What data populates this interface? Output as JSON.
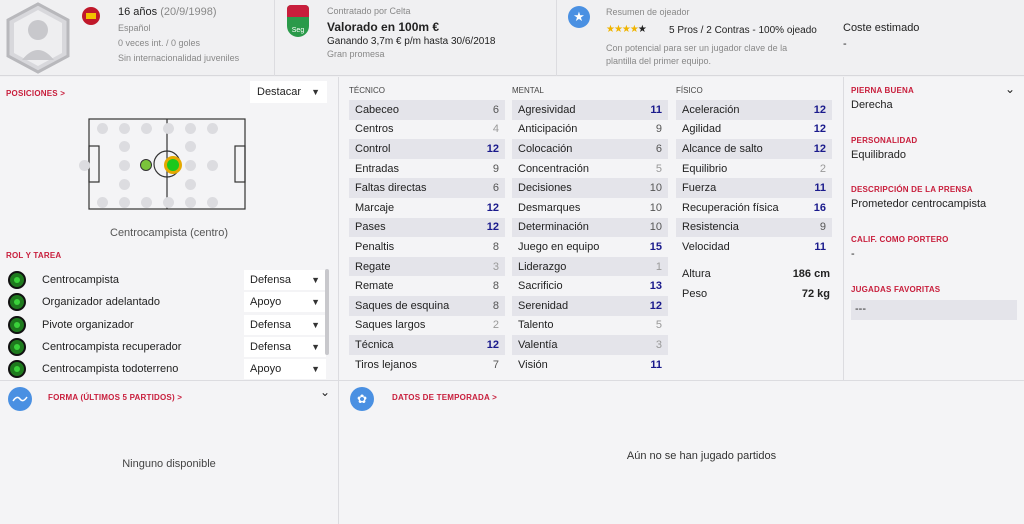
{
  "header": {
    "age_label": "16 años",
    "birth_date": "(20/9/1998)",
    "nationality": "Español",
    "international": "0 veces int. / 0 goles",
    "youth_caps": "Sin internacionalidad juveniles",
    "contract_label": "Contratado por Celta",
    "value": "Valorado en 100m €",
    "wage": "Ganando 3,7m € p/m hasta 30/6/2018",
    "prospect": "Gran promesa",
    "club_badge_text": "Seg",
    "scout_title": "Resumen de ojeador",
    "scout_stars": 4,
    "scout_summary": "5 Pros / 2 Contras - 100% ojeado",
    "scout_note": "Con potencial para ser un jugador clave de la plantilla del primer equipo.",
    "cost_label": "Coste estimado",
    "cost_value": "-"
  },
  "positions": {
    "title": "POSICIONES >",
    "dropdown": "Destacar",
    "position_label": "Centrocampista (centro)"
  },
  "roles": {
    "title": "ROL Y TAREA",
    "items": [
      {
        "name": "Centrocampista",
        "duty": "Defensa"
      },
      {
        "name": "Organizador adelantado",
        "duty": "Apoyo"
      },
      {
        "name": "Pivote organizador",
        "duty": "Defensa"
      },
      {
        "name": "Centrocampista recuperador",
        "duty": "Defensa"
      },
      {
        "name": "Centrocampista todoterreno",
        "duty": "Apoyo"
      }
    ]
  },
  "attributes": {
    "technical_title": "TÉCNICO",
    "mental_title": "MENTAL",
    "physical_title": "FÍSICO",
    "technical": [
      {
        "name": "Cabeceo",
        "value": "6"
      },
      {
        "name": "Centros",
        "value": "4"
      },
      {
        "name": "Control",
        "value": "12"
      },
      {
        "name": "Entradas",
        "value": "9"
      },
      {
        "name": "Faltas directas",
        "value": "6"
      },
      {
        "name": "Marcaje",
        "value": "12"
      },
      {
        "name": "Pases",
        "value": "12"
      },
      {
        "name": "Penaltis",
        "value": "8"
      },
      {
        "name": "Regate",
        "value": "3"
      },
      {
        "name": "Remate",
        "value": "8"
      },
      {
        "name": "Saques de esquina",
        "value": "8"
      },
      {
        "name": "Saques largos",
        "value": "2"
      },
      {
        "name": "Técnica",
        "value": "12"
      },
      {
        "name": "Tiros lejanos",
        "value": "7"
      }
    ],
    "mental": [
      {
        "name": "Agresividad",
        "value": "11"
      },
      {
        "name": "Anticipación",
        "value": "9"
      },
      {
        "name": "Colocación",
        "value": "6"
      },
      {
        "name": "Concentración",
        "value": "5"
      },
      {
        "name": "Decisiones",
        "value": "10"
      },
      {
        "name": "Desmarques",
        "value": "10"
      },
      {
        "name": "Determinación",
        "value": "10"
      },
      {
        "name": "Juego en equipo",
        "value": "15"
      },
      {
        "name": "Liderazgo",
        "value": "1"
      },
      {
        "name": "Sacrificio",
        "value": "13"
      },
      {
        "name": "Serenidad",
        "value": "12"
      },
      {
        "name": "Talento",
        "value": "5"
      },
      {
        "name": "Valentía",
        "value": "3"
      },
      {
        "name": "Visión",
        "value": "11"
      }
    ],
    "physical": [
      {
        "name": "Aceleración",
        "value": "12"
      },
      {
        "name": "Agilidad",
        "value": "12"
      },
      {
        "name": "Alcance de salto",
        "value": "12"
      },
      {
        "name": "Equilibrio",
        "value": "2"
      },
      {
        "name": "Fuerza",
        "value": "11"
      },
      {
        "name": "Recuperación física",
        "value": "16"
      },
      {
        "name": "Resistencia",
        "value": "9"
      },
      {
        "name": "Velocidad",
        "value": "11"
      }
    ],
    "height_label": "Altura",
    "height_value": "186 cm",
    "weight_label": "Peso",
    "weight_value": "72 kg"
  },
  "info": {
    "foot_title": "PIERNA BUENA",
    "foot_value": "Derecha",
    "personality_title": "PERSONALIDAD",
    "personality_value": "Equilibrado",
    "press_title": "DESCRIPCIÓN DE LA PRENSA",
    "press_value": "Prometedor centrocampista",
    "gk_title": "CALIF. COMO PORTERO",
    "gk_value": "-",
    "moves_title": "JUGADAS FAVORITAS",
    "moves_value": "---"
  },
  "form": {
    "title": "FORMA (ÚLTIMOS 5 PARTIDOS) >",
    "empty": "Ninguno disponible"
  },
  "season": {
    "title": "DATOS DE TEMPORADA >",
    "empty": "Aún no se han jugado partidos"
  },
  "colors": {
    "accent_red": "#c81e3c",
    "high_value": "#1a1a8c",
    "role_green": "#3ad23a",
    "club_green": "#2a9a4a",
    "scout_blue": "#4a90e2"
  }
}
